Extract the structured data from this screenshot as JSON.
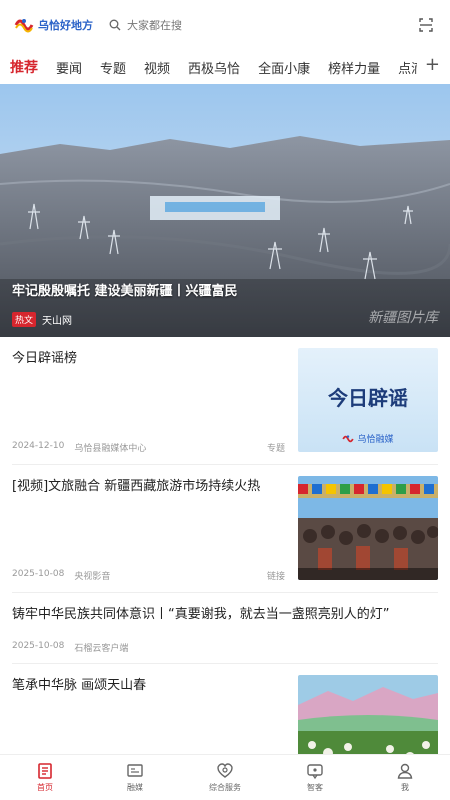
{
  "header": {
    "logo_text": "乌恰好地方",
    "search_placeholder": "大家都在搜"
  },
  "tabs": [
    "推荐",
    "要闻",
    "专题",
    "视频",
    "西极乌恰",
    "全面小康",
    "榜样力量",
    "点滴"
  ],
  "hero": {
    "caption": "牢记殷殷嘱托 建设美丽新疆丨兴疆富民",
    "badge": "热文",
    "source": "天山网",
    "watermark": "新疆图片库"
  },
  "feed": [
    {
      "title": "今日辟谣榜",
      "date": "2024-12-10",
      "source": "乌恰县融媒体中心",
      "tag": "专题",
      "thumb_text": "今日辟谣",
      "thumb_sub": "乌恰融媒"
    },
    {
      "title": "[视频]文旅融合 新疆西藏旅游市场持续火热",
      "date": "2025-10-08",
      "source": "央视影音",
      "tag": "链接"
    },
    {
      "title": "铸牢中华民族共同体意识丨“真要谢我，就去当一盏照亮别人的灯”",
      "date": "2025-10-08",
      "source": "石榴云客户端"
    },
    {
      "title": "笔承中华脉 画颂天山春"
    }
  ],
  "nav": [
    {
      "label": "首页",
      "icon": "home-icon"
    },
    {
      "label": "融媒",
      "icon": "media-icon"
    },
    {
      "label": "综合服务",
      "icon": "service-icon"
    },
    {
      "label": "智客",
      "icon": "chat-icon"
    },
    {
      "label": "我",
      "icon": "user-icon"
    }
  ],
  "colors": {
    "accent": "#d6262e",
    "brand": "#2b63c8"
  }
}
